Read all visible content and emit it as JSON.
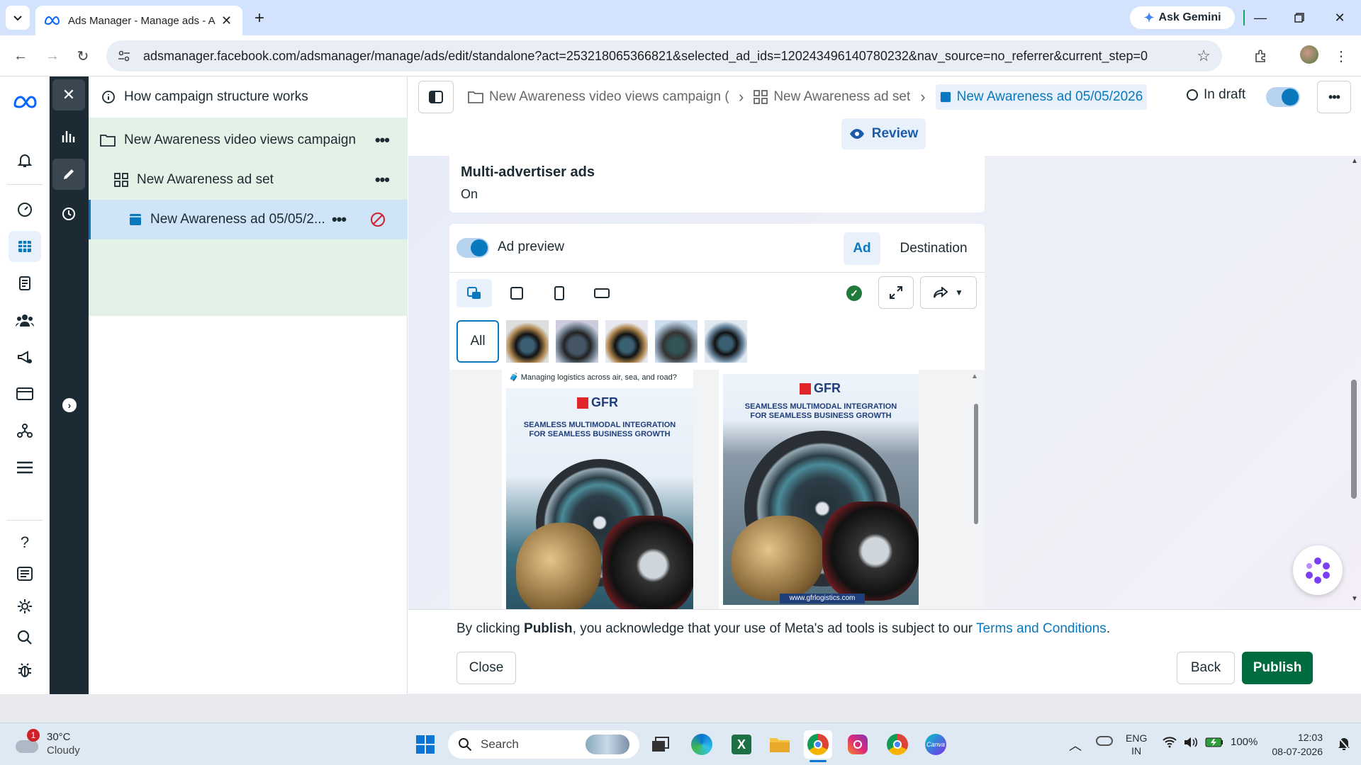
{
  "browser": {
    "tab_title": "Ads Manager - Manage ads - A",
    "new_tab": "+",
    "gemini_label": "Ask Gemini",
    "url": "adsmanager.facebook.com/adsmanager/manage/ads/edit/standalone?act=253218065366821&selected_ad_ids=120243496140780232&nav_source=no_referrer&current_step=0"
  },
  "tree": {
    "help_label": "How campaign structure works",
    "campaign": "New Awareness video views campaign ...",
    "adset": "New Awareness ad set",
    "ad": "New Awareness ad 05/05/2..."
  },
  "breadcrumb": {
    "campaign": "New Awareness video views campaign (",
    "adset": "New Awareness ad set",
    "ad": "New Awareness ad 05/05/2026",
    "status": "In draft"
  },
  "review_label": "Review",
  "multi_adv": {
    "title": "Multi-advertiser ads",
    "value": "On"
  },
  "preview": {
    "label": "Ad preview",
    "tab_ad": "Ad",
    "tab_destination": "Destination",
    "all_label": "All",
    "thumb_count": 5,
    "creative1_caption": "Managing logistics across air, sea, and road?",
    "brand": "GFR",
    "headline_1": "SEAMLESS MULTIMODAL INTEGRATION",
    "headline_2": "FOR SEAMLESS BUSINESS GROWTH",
    "website": "www.gfrlogistics.com"
  },
  "footer": {
    "consent_prefix": "By clicking ",
    "consent_bold": "Publish",
    "consent_mid": ", you acknowledge that your use of Meta's ad tools is subject to our ",
    "consent_link": "Terms and Conditions",
    "consent_end": ".",
    "close": "Close",
    "back": "Back",
    "publish": "Publish"
  },
  "taskbar": {
    "weather_temp": "30°C",
    "weather_desc": "Cloudy",
    "weather_badge": "1",
    "search_label": "Search",
    "lang_1": "ENG",
    "lang_2": "IN",
    "battery": "100%",
    "time": "12:03",
    "date": "08-07-2026"
  },
  "colors": {
    "accent": "#0a78be",
    "publish": "#006b3f",
    "dark_sidebar": "#1c2b33"
  }
}
